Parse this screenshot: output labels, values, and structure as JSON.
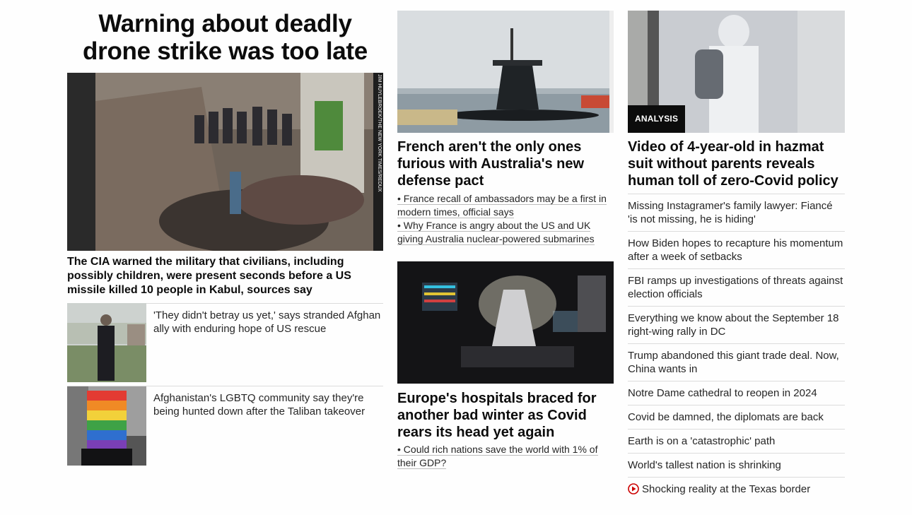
{
  "main": {
    "headline": "Warning about deadly drone strike was too late",
    "hero_photo_credit": "JIM HUYLEBROEK/THE NEW YORK TIMES/REDUX",
    "hero_caption": "The CIA warned the military that civilians, including possibly children, were present seconds before a US missile killed 10 people in Kabul, sources say",
    "related": [
      {
        "text": "'They didn't betray us yet,' says stranded Afghan ally with enduring hope of US rescue",
        "icon": "photo-man-standing"
      },
      {
        "text": "Afghanistan's LGBTQ community say they're being hunted down after the Taliban takeover",
        "icon": "photo-rainbow-face"
      }
    ]
  },
  "middle": {
    "story1": {
      "headline": "French aren't the only ones furious with Australia's new defense pact",
      "bullets": [
        "• France recall of ambassadors may be a first in modern times, official says",
        "• Why France is angry about the US and UK giving Australia nuclear-powered submarines"
      ]
    },
    "story2": {
      "headline": "Europe's hospitals braced for another bad winter as Covid rears its head yet again",
      "bullets": [
        "• Could rich nations save the world with 1% of their GDP?"
      ]
    }
  },
  "right": {
    "badge": "ANALYSIS",
    "headline": "Video of 4-year-old in hazmat suit without parents reveals human toll of zero-Covid policy",
    "list": [
      "Missing Instagramer's family lawyer: Fiancé 'is not missing, he is hiding'",
      "How Biden hopes to recapture his momentum after a week of setbacks",
      "FBI ramps up investigations of threats against election officials",
      "Everything we know about the September 18 right-wing rally in DC",
      "Trump abandoned this giant trade deal. Now, China wants in",
      "Notre Dame cathedral to reopen in 2024",
      "Covid be damned, the diplomats are back",
      "Earth is on a 'catastrophic' path",
      "World's tallest nation is shrinking",
      "Shocking reality at the Texas border"
    ],
    "video_icon_color": "#cc0000"
  }
}
